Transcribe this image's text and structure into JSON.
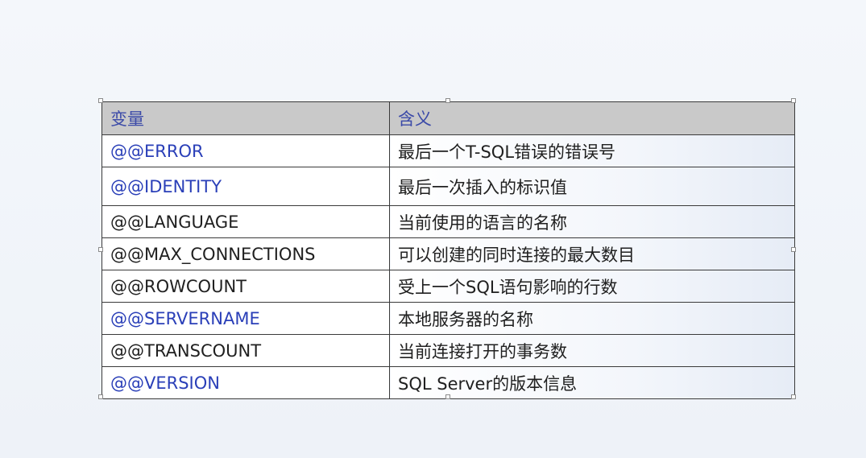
{
  "table": {
    "headers": [
      "变量",
      "含义"
    ],
    "rows": [
      {
        "variable": "@@ERROR",
        "meaning": "最后一个T-SQL错误的错误号",
        "var_color": "blue"
      },
      {
        "variable": "@@IDENTITY",
        "meaning": "最后一次插入的标识值",
        "var_color": "blue"
      },
      {
        "variable": "@@LANGUAGE",
        "meaning": "当前使用的语言的名称",
        "var_color": "black"
      },
      {
        "variable": "@@MAX_CONNECTIONS",
        "meaning": "可以创建的同时连接的最大数目",
        "var_color": "black"
      },
      {
        "variable": "@@ROWCOUNT",
        "meaning": "受上一个SQL语句影响的行数",
        "var_color": "black"
      },
      {
        "variable": "@@SERVERNAME",
        "meaning": "本地服务器的名称",
        "var_color": "blue"
      },
      {
        "variable": "@@TRANSCOUNT",
        "meaning": "当前连接打开的事务数",
        "var_color": "black"
      },
      {
        "variable": "@@VERSION",
        "meaning": "SQL Server的版本信息",
        "var_color": "blue"
      }
    ]
  },
  "colors": {
    "header_bg": "#c9c9c9",
    "header_text": "#3b4aa8",
    "link_blue": "#2a3fb8",
    "text_black": "#202020",
    "border": "#3a3a3a"
  }
}
